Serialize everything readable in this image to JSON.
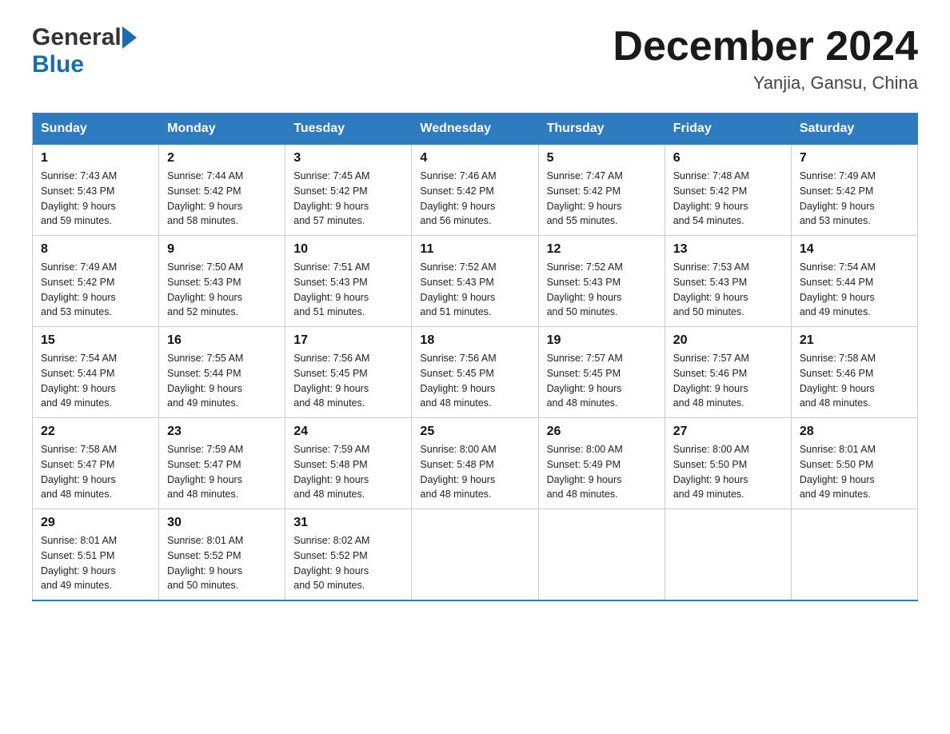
{
  "logo": {
    "general": "General",
    "blue": "Blue",
    "arrow_color": "#1a6baf"
  },
  "title": {
    "month_year": "December 2024",
    "location": "Yanjia, Gansu, China"
  },
  "weekdays": [
    "Sunday",
    "Monday",
    "Tuesday",
    "Wednesday",
    "Thursday",
    "Friday",
    "Saturday"
  ],
  "weeks": [
    [
      {
        "day": "1",
        "sunrise": "7:43 AM",
        "sunset": "5:43 PM",
        "daylight": "9 hours and 59 minutes."
      },
      {
        "day": "2",
        "sunrise": "7:44 AM",
        "sunset": "5:42 PM",
        "daylight": "9 hours and 58 minutes."
      },
      {
        "day": "3",
        "sunrise": "7:45 AM",
        "sunset": "5:42 PM",
        "daylight": "9 hours and 57 minutes."
      },
      {
        "day": "4",
        "sunrise": "7:46 AM",
        "sunset": "5:42 PM",
        "daylight": "9 hours and 56 minutes."
      },
      {
        "day": "5",
        "sunrise": "7:47 AM",
        "sunset": "5:42 PM",
        "daylight": "9 hours and 55 minutes."
      },
      {
        "day": "6",
        "sunrise": "7:48 AM",
        "sunset": "5:42 PM",
        "daylight": "9 hours and 54 minutes."
      },
      {
        "day": "7",
        "sunrise": "7:49 AM",
        "sunset": "5:42 PM",
        "daylight": "9 hours and 53 minutes."
      }
    ],
    [
      {
        "day": "8",
        "sunrise": "7:49 AM",
        "sunset": "5:42 PM",
        "daylight": "9 hours and 53 minutes."
      },
      {
        "day": "9",
        "sunrise": "7:50 AM",
        "sunset": "5:43 PM",
        "daylight": "9 hours and 52 minutes."
      },
      {
        "day": "10",
        "sunrise": "7:51 AM",
        "sunset": "5:43 PM",
        "daylight": "9 hours and 51 minutes."
      },
      {
        "day": "11",
        "sunrise": "7:52 AM",
        "sunset": "5:43 PM",
        "daylight": "9 hours and 51 minutes."
      },
      {
        "day": "12",
        "sunrise": "7:52 AM",
        "sunset": "5:43 PM",
        "daylight": "9 hours and 50 minutes."
      },
      {
        "day": "13",
        "sunrise": "7:53 AM",
        "sunset": "5:43 PM",
        "daylight": "9 hours and 50 minutes."
      },
      {
        "day": "14",
        "sunrise": "7:54 AM",
        "sunset": "5:44 PM",
        "daylight": "9 hours and 49 minutes."
      }
    ],
    [
      {
        "day": "15",
        "sunrise": "7:54 AM",
        "sunset": "5:44 PM",
        "daylight": "9 hours and 49 minutes."
      },
      {
        "day": "16",
        "sunrise": "7:55 AM",
        "sunset": "5:44 PM",
        "daylight": "9 hours and 49 minutes."
      },
      {
        "day": "17",
        "sunrise": "7:56 AM",
        "sunset": "5:45 PM",
        "daylight": "9 hours and 48 minutes."
      },
      {
        "day": "18",
        "sunrise": "7:56 AM",
        "sunset": "5:45 PM",
        "daylight": "9 hours and 48 minutes."
      },
      {
        "day": "19",
        "sunrise": "7:57 AM",
        "sunset": "5:45 PM",
        "daylight": "9 hours and 48 minutes."
      },
      {
        "day": "20",
        "sunrise": "7:57 AM",
        "sunset": "5:46 PM",
        "daylight": "9 hours and 48 minutes."
      },
      {
        "day": "21",
        "sunrise": "7:58 AM",
        "sunset": "5:46 PM",
        "daylight": "9 hours and 48 minutes."
      }
    ],
    [
      {
        "day": "22",
        "sunrise": "7:58 AM",
        "sunset": "5:47 PM",
        "daylight": "9 hours and 48 minutes."
      },
      {
        "day": "23",
        "sunrise": "7:59 AM",
        "sunset": "5:47 PM",
        "daylight": "9 hours and 48 minutes."
      },
      {
        "day": "24",
        "sunrise": "7:59 AM",
        "sunset": "5:48 PM",
        "daylight": "9 hours and 48 minutes."
      },
      {
        "day": "25",
        "sunrise": "8:00 AM",
        "sunset": "5:48 PM",
        "daylight": "9 hours and 48 minutes."
      },
      {
        "day": "26",
        "sunrise": "8:00 AM",
        "sunset": "5:49 PM",
        "daylight": "9 hours and 48 minutes."
      },
      {
        "day": "27",
        "sunrise": "8:00 AM",
        "sunset": "5:50 PM",
        "daylight": "9 hours and 49 minutes."
      },
      {
        "day": "28",
        "sunrise": "8:01 AM",
        "sunset": "5:50 PM",
        "daylight": "9 hours and 49 minutes."
      }
    ],
    [
      {
        "day": "29",
        "sunrise": "8:01 AM",
        "sunset": "5:51 PM",
        "daylight": "9 hours and 49 minutes."
      },
      {
        "day": "30",
        "sunrise": "8:01 AM",
        "sunset": "5:52 PM",
        "daylight": "9 hours and 50 minutes."
      },
      {
        "day": "31",
        "sunrise": "8:02 AM",
        "sunset": "5:52 PM",
        "daylight": "9 hours and 50 minutes."
      },
      null,
      null,
      null,
      null
    ]
  ],
  "labels": {
    "sunrise": "Sunrise:",
    "sunset": "Sunset:",
    "daylight": "Daylight:"
  }
}
